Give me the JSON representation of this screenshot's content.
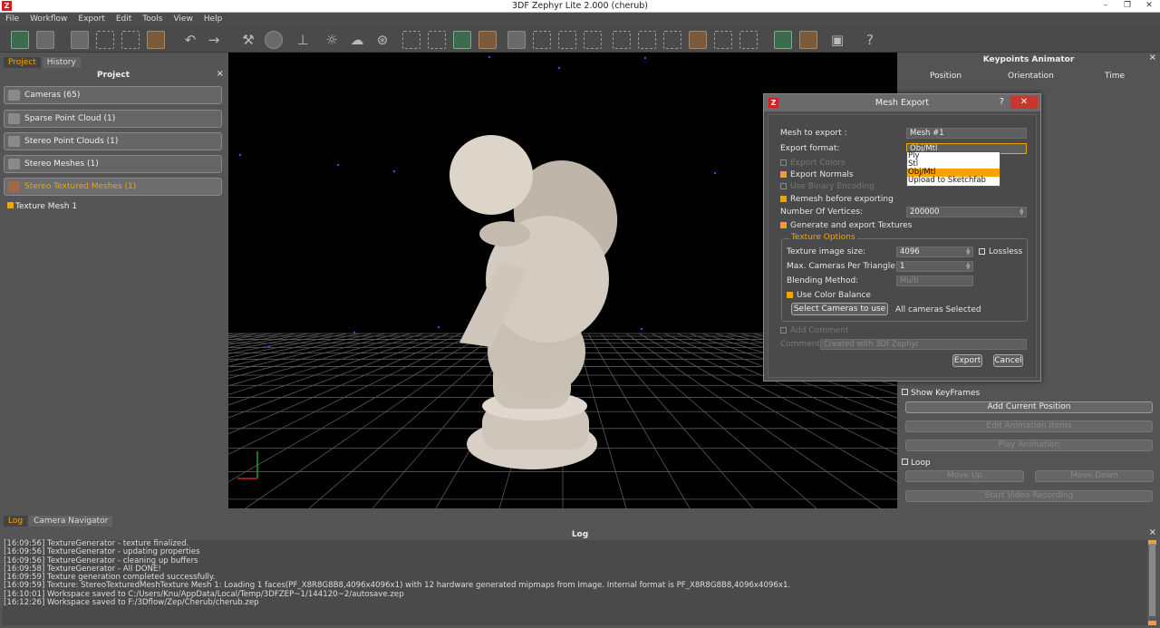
{
  "window": {
    "title": "3DF Zephyr Lite 2.000 (cherub)",
    "logo": "Z",
    "minimize": "–",
    "restore": "❐",
    "close": "✕"
  },
  "menu": [
    "File",
    "Workflow",
    "Export",
    "Edit",
    "Tools",
    "View",
    "Help"
  ],
  "left_panel": {
    "tabs": {
      "project": "Project",
      "history": "History"
    },
    "header": "Project",
    "close": "×",
    "categories": [
      {
        "label": "Cameras (65)",
        "icon": "camera-icon"
      },
      {
        "label": "Sparse Point Cloud (1)",
        "icon": "sparse-cloud-icon"
      },
      {
        "label": "Stereo Point Clouds (1)",
        "icon": "dense-cloud-icon"
      },
      {
        "label": "Stereo Meshes (1)",
        "icon": "mesh-icon"
      },
      {
        "label": "Stereo Textured Meshes (1)",
        "icon": "textured-mesh-icon"
      }
    ],
    "tree_item": "Texture Mesh 1"
  },
  "right_panel": {
    "title": "Keypoints Animator",
    "close": "×",
    "columns": [
      "Position",
      "Orientation",
      "Time"
    ],
    "show_keyframes": "Show KeyFrames",
    "add_current_position": "Add Current Position",
    "edit_animation": "Edit Animation Items",
    "play_animation": "Play Animation",
    "loop": "Loop",
    "move_up": "Move Up",
    "move_down": "Move Down",
    "start_video": "Start Video Recording"
  },
  "dialog": {
    "title": "Mesh Export",
    "logo": "Z",
    "help": "?",
    "close": "✕",
    "mesh_to_export_label": "Mesh to export :",
    "mesh_to_export_value": "Mesh #1",
    "export_format_label": "Export format:",
    "export_format_value": "Obj/Mtl",
    "format_options": [
      "Ply",
      "Stl",
      "Obj/Mtl",
      "Upload to Sketchfab"
    ],
    "selected_format": "Obj/Mtl",
    "export_colors": "Export Colors",
    "export_normals": "Export Normals",
    "use_binary": "Use Binary Encoding",
    "remesh": "Remesh before exporting",
    "num_vertices_label": "Number Of Vertices:",
    "num_vertices_value": "200000",
    "generate_textures": "Generate and export Textures",
    "texture_options": "Texture Options",
    "texture_size_label": "Texture image size:",
    "texture_size_value": "4096",
    "lossless": "Lossless",
    "max_cameras_label": "Max. Cameras Per Triangle:",
    "max_cameras_value": "1",
    "blending_label": "Blending Method:",
    "blending_value": "Multi",
    "use_color_balance": "Use Color Balance",
    "select_cameras": "Select Cameras to use",
    "cameras_status": "All cameras Selected",
    "add_comment": "Add Comment",
    "comment_label": "Comment:",
    "comment_value": "Created with 3Df Zephyr",
    "export_button": "Export",
    "cancel_button": "Cancel"
  },
  "log_panel": {
    "tabs": {
      "log": "Log",
      "camera_navigator": "Camera Navigator"
    },
    "title": "Log",
    "close": "×",
    "lines": [
      "[16:09:56] TextureGenerator - texture finalized.",
      "[16:09:56] TextureGenerator - updating properties",
      "[16:09:56] TextureGenerator - cleaning up buffers",
      "[16:09:58] TextureGenerator - All DONE!",
      "[16:09:59] Texture generation completed successfully.",
      "[16:09:59] Texture: StereoTexturedMeshTexture Mesh 1: Loading 1 faces(PF_X8R8G8B8,4096x4096x1) with 12 hardware generated mipmaps from Image. Internal format is PF_X8R8G8B8,4096x4096x1.",
      "[16:10:01] Workspace saved to C:/Users/Knu/AppData/Local/Temp/3DFZEP~1/144120~2/autosave.zep",
      "[16:12:26] Workspace saved to F:/3Dflow/Zep/Cherub/cherub.zep"
    ]
  },
  "colors": {
    "accent": "#f4a300",
    "background": "#545454",
    "viewport": "#000000",
    "close_red": "#c8372d"
  }
}
